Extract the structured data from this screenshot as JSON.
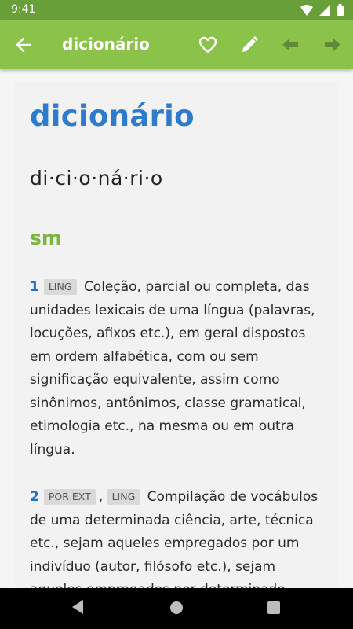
{
  "status": {
    "time": "9:41"
  },
  "app_bar": {
    "title": "dicionário"
  },
  "entry": {
    "headword": "dicionário",
    "syllables": "di·ci·o·ná·ri·o",
    "pos": "sm",
    "definitions": [
      {
        "number": "1",
        "tags": [
          "LING"
        ],
        "text": "Coleção, parcial ou completa, das unidades lexicais de uma língua (palavras, locuções, afixos etc.), em geral dispostos em ordem alfabética, com ou sem significação equivalente, assim como sinônimos, antônimos, classe gramatical, etimologia etc., na mesma ou em outra língua."
      },
      {
        "number": "2",
        "tags": [
          "POR EXT",
          "LING"
        ],
        "text": "Compilação de vocábulos de uma determinada ciência, arte, técnica etc., sejam aqueles empregados por um indivíduo (autor, filósofo etc.), sejam aqueles empregados por determinado"
      }
    ]
  },
  "colors": {
    "status_bar": "#689f38",
    "app_bar": "#8bc34a",
    "headword": "#2e7cc9",
    "pos": "#7cb342"
  }
}
